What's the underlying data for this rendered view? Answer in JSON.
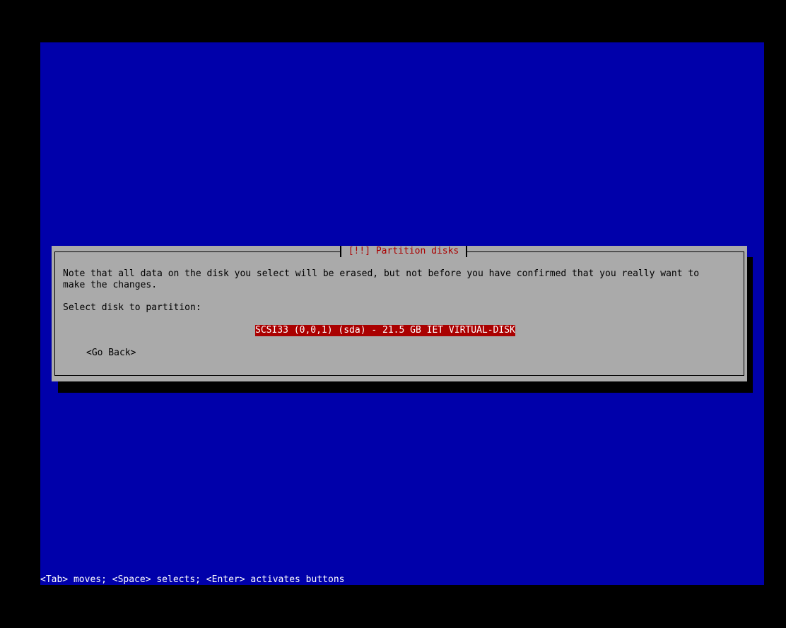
{
  "dialog": {
    "title": "[!!] Partition disks",
    "note_line1": "Note that all data on the disk you select will be erased, but not before you have confirmed that you really want to",
    "note_line2": "make the changes.",
    "prompt": "Select disk to partition:",
    "disks": [
      {
        "label": "SCSI33 (0,0,1) (sda) - 21.5 GB IET VIRTUAL-DISK",
        "selected": true
      }
    ],
    "back_label": "<Go Back>"
  },
  "footer": {
    "help": "<Tab> moves; <Space> selects; <Enter> activates buttons"
  },
  "colors": {
    "screen_bg": "#0000aa",
    "dialog_bg": "#aaaaaa",
    "title_fg": "#aa0000",
    "selection_bg": "#aa0000",
    "selection_fg": "#ffffff"
  }
}
